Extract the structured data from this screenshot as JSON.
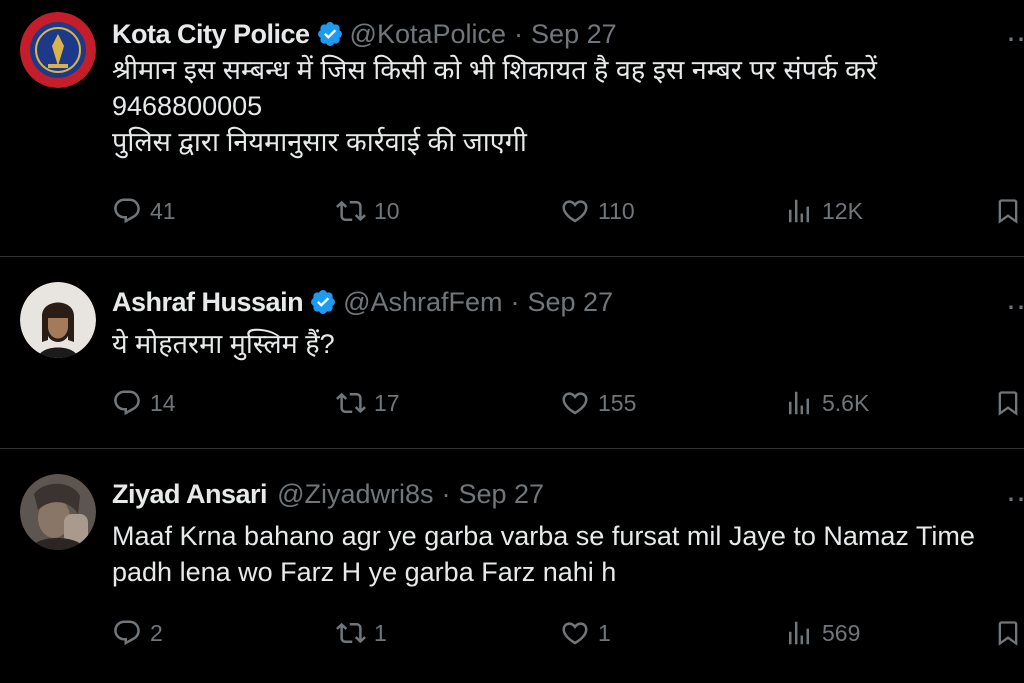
{
  "tweets": [
    {
      "name": "Kota City Police",
      "handle": "@KotaPolice",
      "separator": "·",
      "date": "Sep 27",
      "verified": true,
      "avatar_icon": "police-emblem-icon",
      "lines": [
        "श्रीमान इस सम्बन्ध में जिस किसी को भी शिकायत है वह इस नम्बर पर संपर्क करें",
        "9468800005",
        "पुलिस द्वारा नियमानुसार कार्रवाई की जाएगी"
      ],
      "replies": "41",
      "reposts": "10",
      "likes": "110",
      "views": "12K"
    },
    {
      "name": "Ashraf Hussain",
      "handle": "@AshrafFem",
      "separator": "·",
      "date": "Sep 27",
      "verified": true,
      "avatar_icon": "user-avatar",
      "lines": [
        "ये मोहतरमा मुस्लिम हैं?"
      ],
      "replies": "14",
      "reposts": "17",
      "likes": "155",
      "views": "5.6K"
    },
    {
      "name": "Ziyad Ansari",
      "handle": "@Ziyadwri8s",
      "separator": "·",
      "date": "Sep 27",
      "verified": false,
      "avatar_icon": "user-avatar",
      "lines": [
        "Maaf Krna bahano agr ye garba varba se fursat mil Jaye to Namaz Time",
        "padh lena wo Farz H ye garba Farz nahi h"
      ],
      "replies": "2",
      "reposts": "1",
      "likes": "1",
      "views": "569"
    }
  ],
  "colors": {
    "background": "#000000",
    "text": "#e7e9ea",
    "muted": "#71767b",
    "verified": "#1d9bf0",
    "divider": "#2f3336"
  },
  "icons": [
    "reply-icon",
    "repost-icon",
    "like-icon",
    "views-icon",
    "bookmark-icon",
    "verified-badge-icon"
  ]
}
